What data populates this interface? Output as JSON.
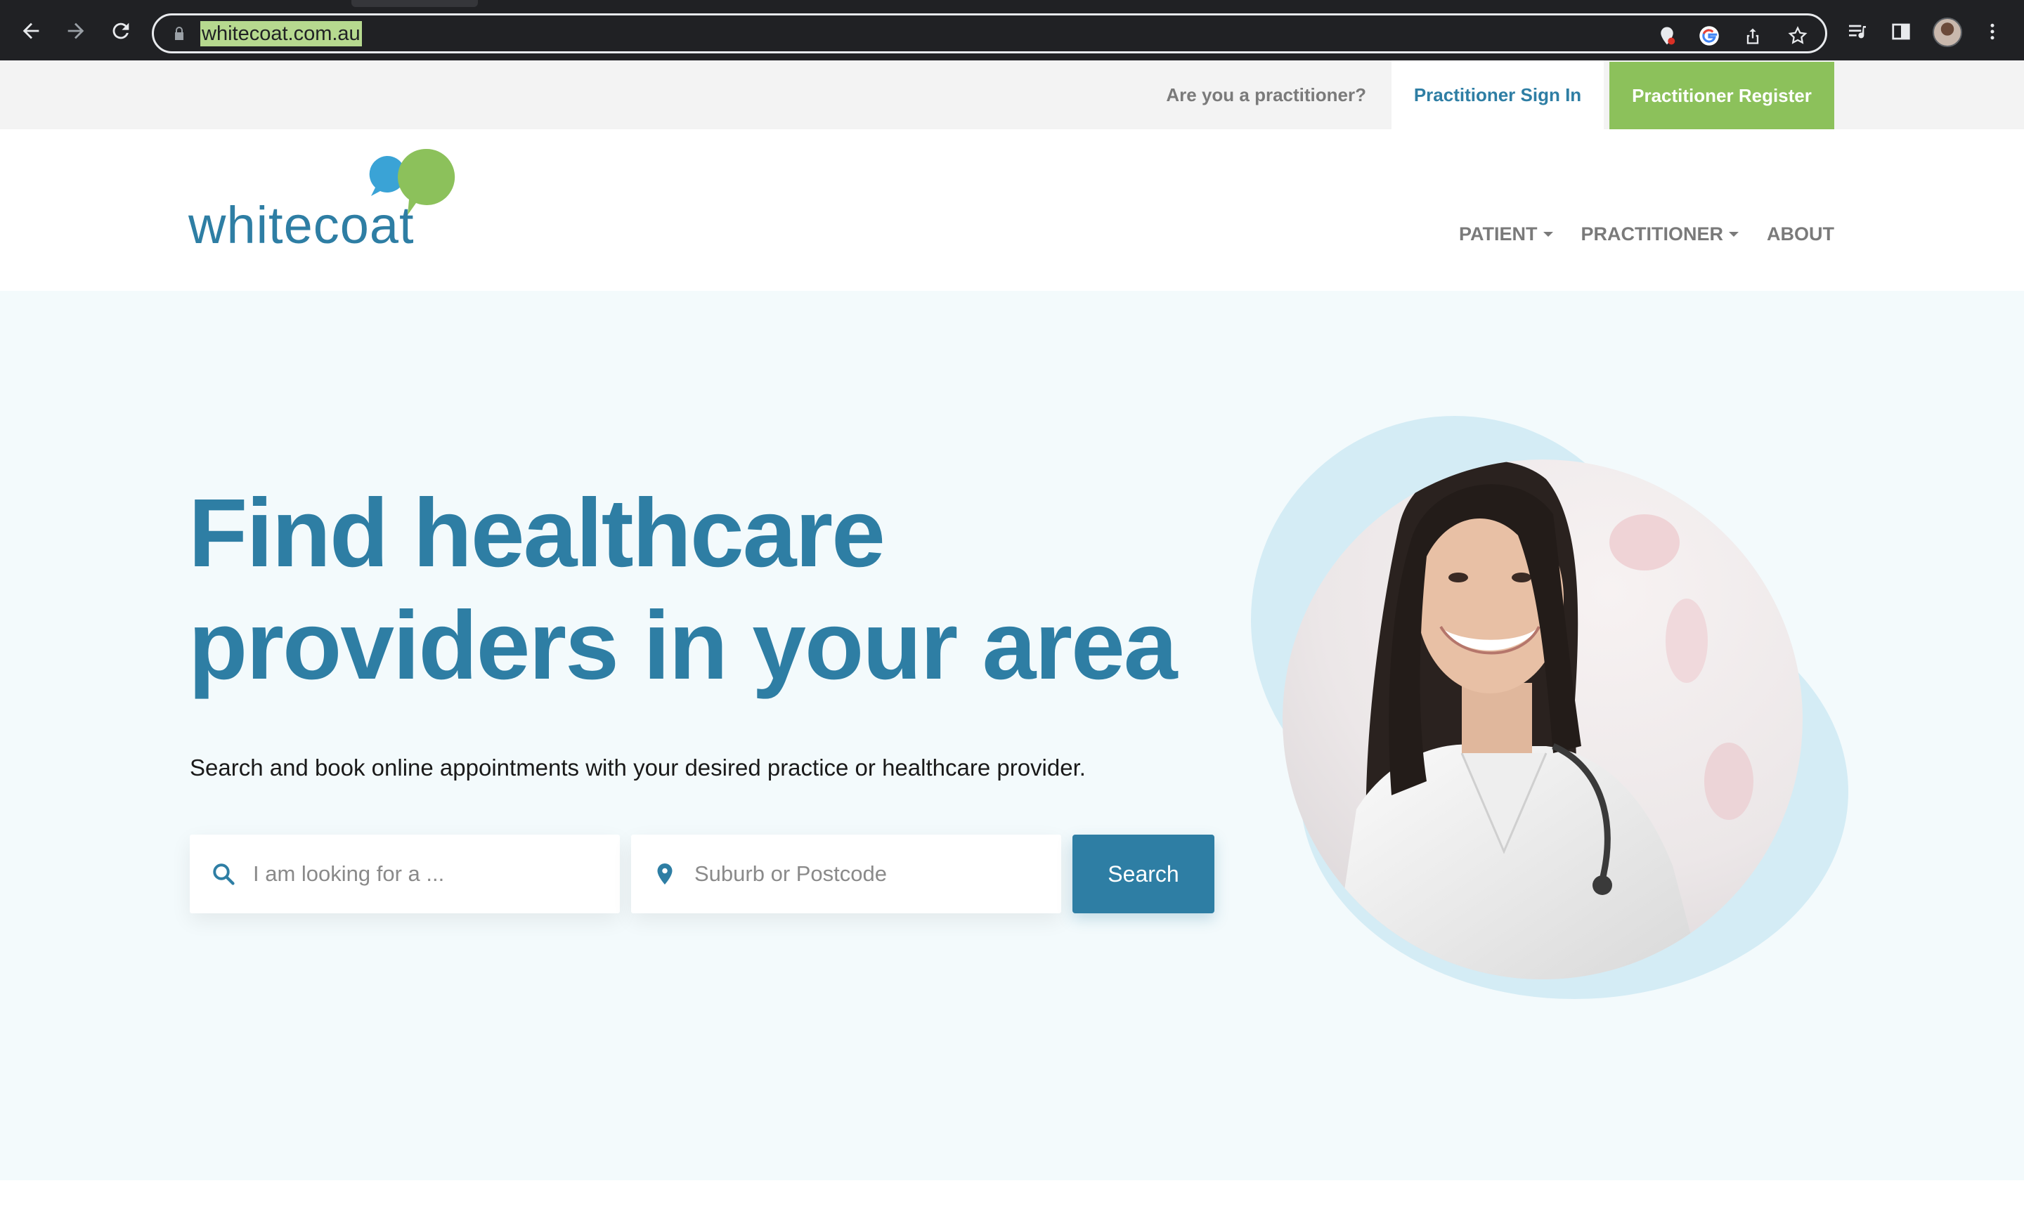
{
  "browser": {
    "url": "whitecoat.com.au",
    "back_icon": "back-arrow-icon",
    "forward_icon": "forward-arrow-icon",
    "reload_icon": "reload-icon"
  },
  "utility_bar": {
    "question": "Are you a practitioner?",
    "sign_in": "Practitioner Sign In",
    "register": "Practitioner Register"
  },
  "header": {
    "logo_text": "whitecoat",
    "nav": [
      {
        "label": "PATIENT",
        "has_dropdown": true
      },
      {
        "label": "PRACTITIONER",
        "has_dropdown": true
      },
      {
        "label": "ABOUT",
        "has_dropdown": false
      }
    ]
  },
  "hero": {
    "headline_line1": "Find healthcare",
    "headline_line2": "providers in your area",
    "subtitle": "Search and book online appointments with your desired practice or healthcare provider.",
    "search": {
      "what_placeholder": "I am looking for a ...",
      "where_placeholder": "Suburb or Postcode",
      "button": "Search"
    }
  },
  "colors": {
    "brand_blue": "#2e7ea4",
    "brand_green": "#8cc15b",
    "hero_bg": "#f3fafc",
    "blob_light_blue": "#d4ecf5"
  }
}
